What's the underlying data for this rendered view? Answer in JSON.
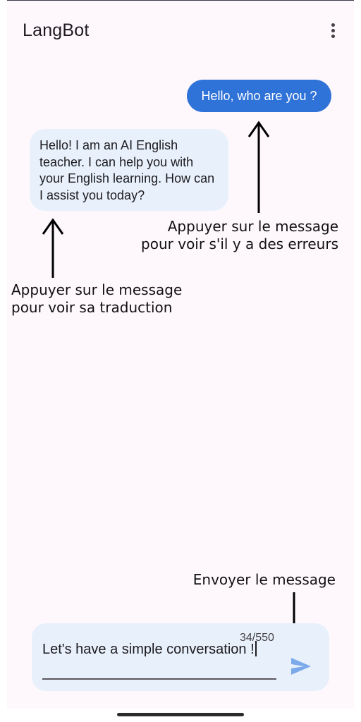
{
  "app_bar": {
    "title": "LangBot",
    "menu_icon": "more-vert-icon"
  },
  "chat": {
    "user_message": "Hello, who are you ?",
    "bot_message": "Hello! I am an AI English teacher. I can help you with your English learning. How can I assist you today?"
  },
  "annotations": {
    "user_tip_line1": "Appuyer sur le message",
    "user_tip_line2": "pour voir s'il y a des erreurs",
    "bot_tip_line1": "Appuyer sur le message",
    "bot_tip_line2": "pour voir sa traduction",
    "send_tip": "Envoyer le message"
  },
  "composer": {
    "value": "Let's have a simple conversation !",
    "char_count": "34/550",
    "send_icon": "send-icon"
  },
  "colors": {
    "user_bubble": "#2f72d8",
    "bot_bubble": "#e8f1fb",
    "send_icon": "#7ba9ea",
    "background": "#fef8fd"
  }
}
